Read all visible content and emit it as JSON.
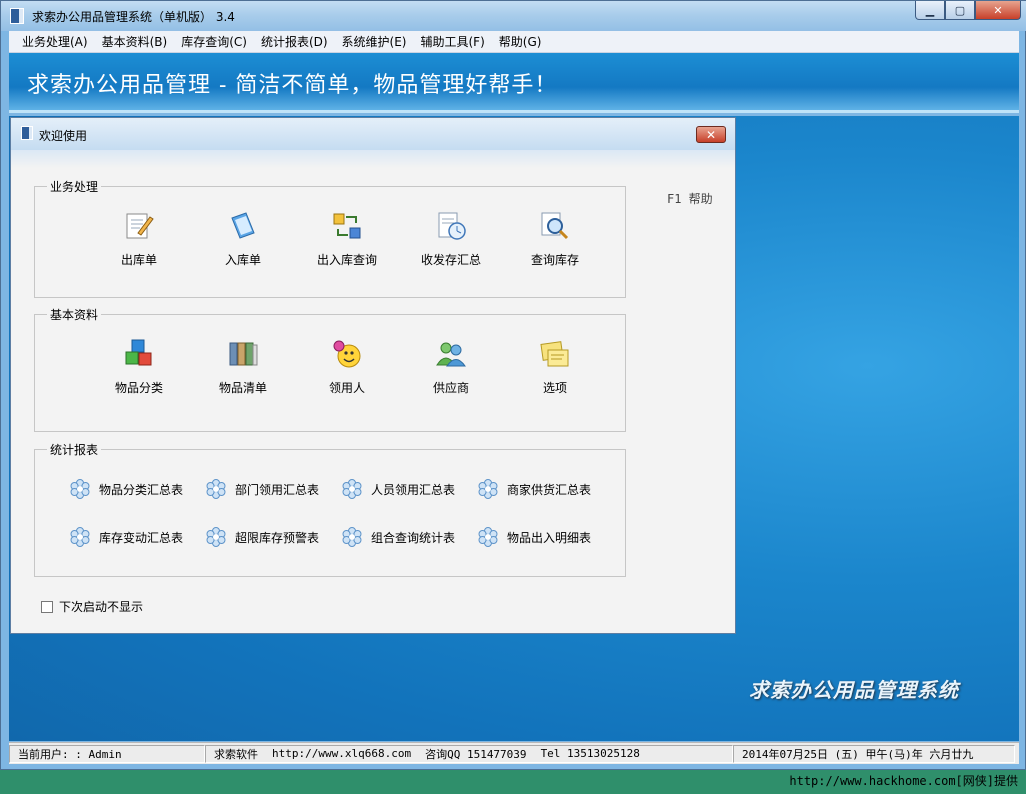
{
  "window": {
    "title": "求索办公用品管理系统（单机版） 3.4"
  },
  "menu": [
    "业务处理(A)",
    "基本资料(B)",
    "库存查询(C)",
    "统计报表(D)",
    "系统维护(E)",
    "辅助工具(F)",
    "帮助(G)"
  ],
  "banner": {
    "slogan": "求索办公用品管理 - 简洁不简单，物品管理好帮手！"
  },
  "watermark": "求索办公用品管理系统",
  "dialog": {
    "title": "欢迎使用",
    "help": "F1 帮助",
    "business": {
      "label": "业务处理",
      "items": [
        "出库单",
        "入库单",
        "出入库查询",
        "收发存汇总",
        "查询库存"
      ]
    },
    "basic": {
      "label": "基本资料",
      "items": [
        "物品分类",
        "物品清单",
        "领用人",
        "供应商",
        "选项"
      ]
    },
    "reports": {
      "label": "统计报表",
      "items": [
        "物品分类汇总表",
        "部门领用汇总表",
        "人员领用汇总表",
        "商家供货汇总表",
        "库存变动汇总表",
        "超限库存预警表",
        "组合查询统计表",
        "物品出入明细表"
      ]
    },
    "checkbox_label": "下次启动不显示"
  },
  "status": {
    "user": "当前用户: : Admin",
    "company": "求索软件",
    "url": "http://www.xlq668.com",
    "qq": "咨询QQ 151477039",
    "tel": "Tel 13513025128",
    "date": "2014年07月25日 (五) 甲午(马)年 六月廿九"
  },
  "credit": "http://www.hackhome.com[网侠]提供",
  "colors": {
    "banner": "#1479c3",
    "desktop": "#1b86cc",
    "close": "#c7402a"
  }
}
